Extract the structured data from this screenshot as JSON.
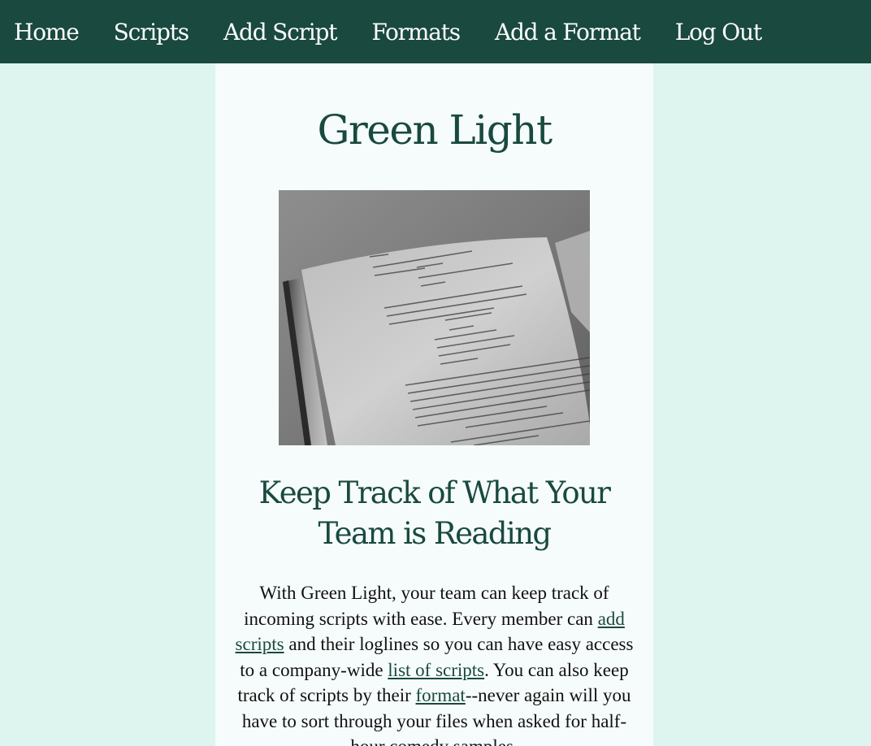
{
  "nav": {
    "home": "Home",
    "scripts": "Scripts",
    "add_script": "Add Script",
    "formats": "Formats",
    "add_format": "Add a Format",
    "log_out": "Log Out"
  },
  "page": {
    "title": "Green Light",
    "subtitle": "Keep Track of What Your Team is Reading"
  },
  "intro": {
    "part1": "With Green Light, your team can keep track of incoming scripts with ease. Every member can ",
    "link_add_scripts": "add scripts",
    "part2": " and their loglines so you can have easy access to a company-wide ",
    "link_list_scripts": "list of scripts",
    "part3": ". You can also keep track of scripts by their ",
    "link_format": "format",
    "part4": "--never again will you have to sort through your files when asked for half-hour comedy samples."
  },
  "colors": {
    "nav_bg": "#19493f",
    "page_bg": "#def4ee",
    "content_bg": "#f6fcfb",
    "accent": "#19493f"
  },
  "hero_image": {
    "icon": "open-screenplay-book-photo"
  }
}
